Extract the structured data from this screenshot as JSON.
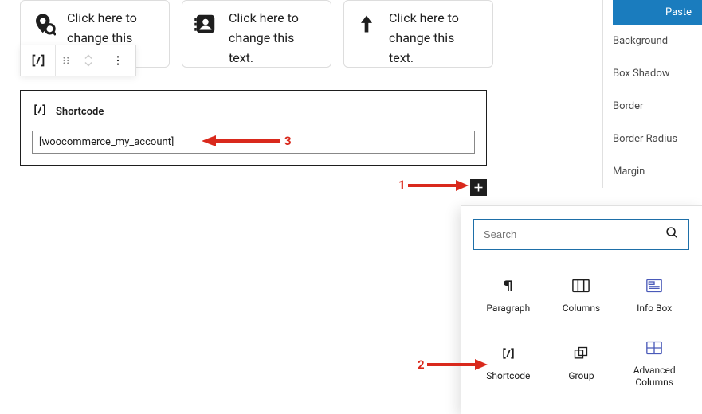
{
  "cards": [
    {
      "text": "Click here to change this"
    },
    {
      "text": "Click here to change this text."
    },
    {
      "text": "Click here to change this text."
    }
  ],
  "shortcode": {
    "title": "Shortcode",
    "value": "[woocommerce_my_account]"
  },
  "sidebar": {
    "paste": "Paste",
    "items": [
      "Background",
      "Box Shadow",
      "Border",
      "Border Radius",
      "Margin"
    ]
  },
  "inserter": {
    "search_placeholder": "Search",
    "blocks": [
      {
        "label": "Paragraph"
      },
      {
        "label": "Columns"
      },
      {
        "label": "Info Box"
      },
      {
        "label": "Shortcode"
      },
      {
        "label": "Group"
      },
      {
        "label": "Advanced Columns"
      }
    ]
  },
  "annotations": {
    "n1": "1",
    "n2": "2",
    "n3": "3"
  }
}
